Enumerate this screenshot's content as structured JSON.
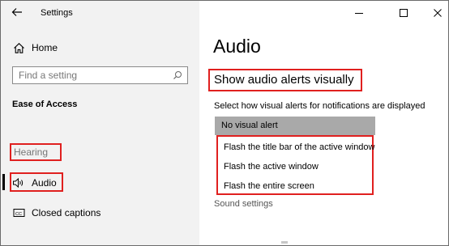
{
  "window": {
    "title": "Settings",
    "back_icon": "arrow-left-icon",
    "controls": [
      "minimize-icon",
      "maximize-icon",
      "close-icon"
    ]
  },
  "sidebar": {
    "home": {
      "label": "Home",
      "icon": "home-icon"
    },
    "search": {
      "placeholder": "Find a setting",
      "icon": "search-icon"
    },
    "section_heading": "Ease of Access",
    "group_label": "Hearing",
    "items": [
      {
        "label": "Audio",
        "icon": "speaker-icon",
        "selected": true
      },
      {
        "label": "Closed captions",
        "icon": "closed-captions-icon",
        "selected": false
      }
    ]
  },
  "main": {
    "title": "Audio",
    "subheading": "Show audio alerts visually",
    "dropdown": {
      "label": "Select how visual alerts for notifications are displayed",
      "selected": "No visual alert",
      "options": [
        "Flash the title bar of the active window",
        "Flash the active window",
        "Flash the entire screen"
      ]
    },
    "related_link": "Sound settings"
  },
  "colors": {
    "highlight_border": "#e0201f",
    "selected_option_bg": "#a9a9a9",
    "sidebar_bg": "#f2f2f2"
  }
}
